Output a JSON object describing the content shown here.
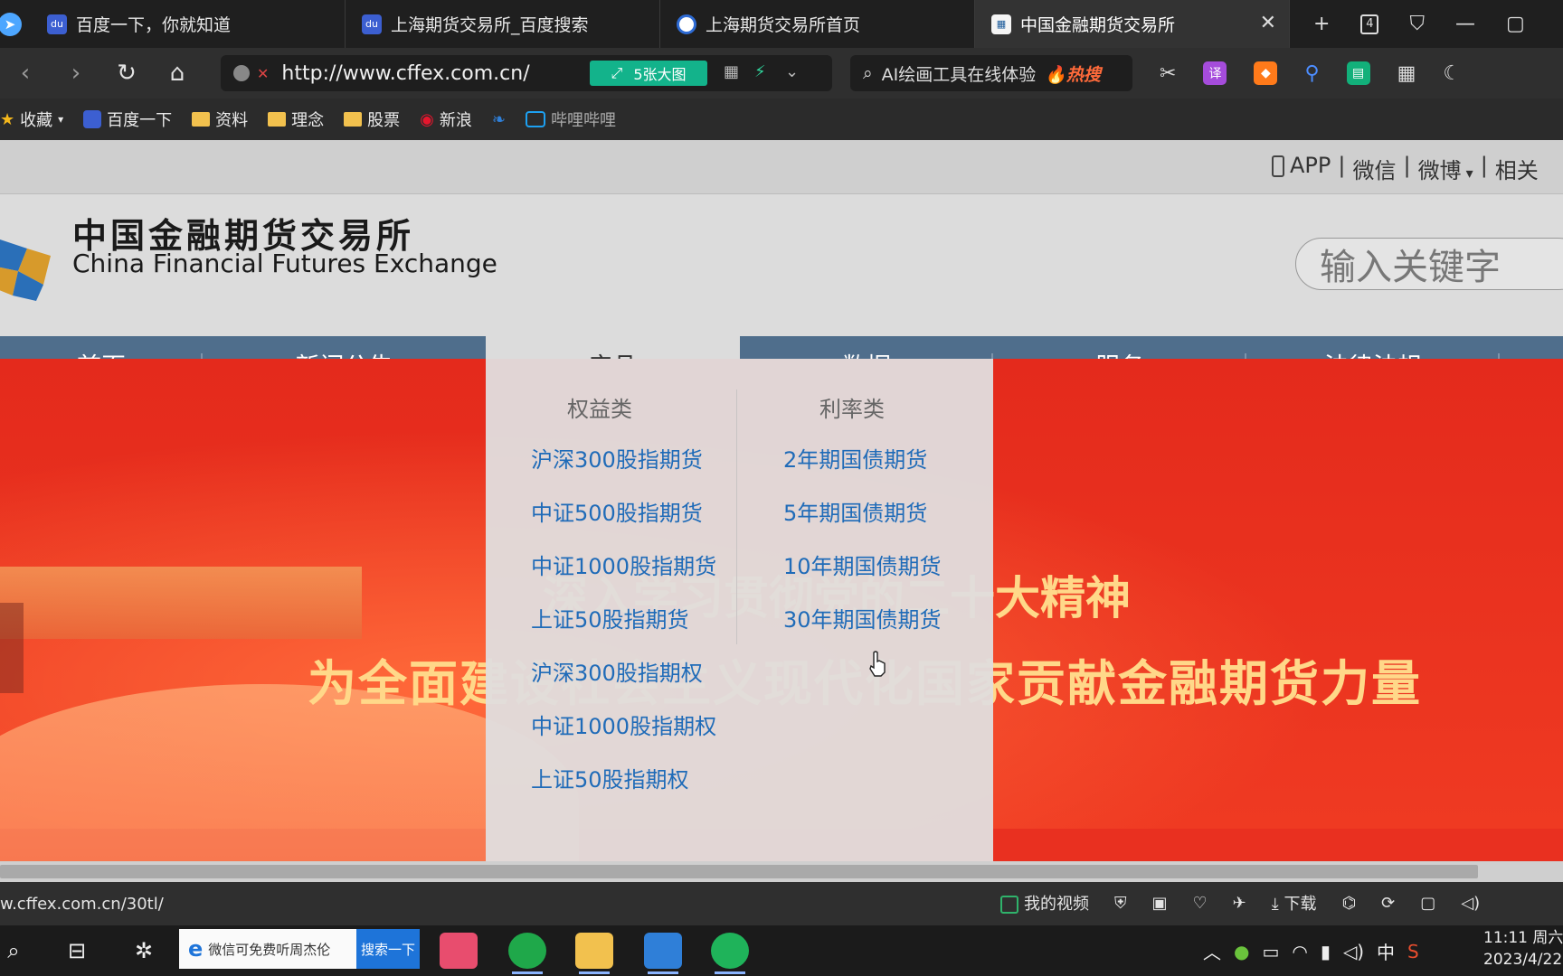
{
  "tabs": [
    {
      "label": "百度一下，你就知道",
      "favicon": "baidu-icon"
    },
    {
      "label": "上海期货交易所_百度搜索",
      "favicon": "baidu-icon"
    },
    {
      "label": "上海期货交易所首页",
      "favicon": "shfe-icon"
    },
    {
      "label": "中国金融期货交易所",
      "favicon": "cffex-icon",
      "active": true
    }
  ],
  "tab_actions": {
    "new_tab": "+",
    "tab_count": "4"
  },
  "address": {
    "url": "http://www.cffex.com.cn/",
    "image_button": "5张大图"
  },
  "search": {
    "query": "AI绘画工具在线体验",
    "hot_label": "热搜"
  },
  "toolbar_icons": {
    "translate": "译"
  },
  "bookmarks": [
    {
      "label": "收藏",
      "icon": "star-icon"
    },
    {
      "label": "百度一下",
      "icon": "baidu-icon"
    },
    {
      "label": "资料",
      "icon": "folder-icon"
    },
    {
      "label": "理念",
      "icon": "folder-icon"
    },
    {
      "label": "股票",
      "icon": "folder-icon"
    },
    {
      "label": "新浪",
      "icon": "weibo-icon"
    },
    {
      "label": "哔哩哔哩",
      "icon": "bilibili-icon"
    }
  ],
  "site": {
    "top_links": [
      "APP",
      "微信",
      "微博",
      "相关"
    ],
    "logo": {
      "cn": "中国金融期货交易所",
      "en": "China Financial Futures Exchange"
    },
    "search_placeholder": "输入关键字",
    "nav": [
      "首页",
      "新闻公告",
      "产品",
      "数据",
      "服务",
      "法律法规"
    ],
    "active_nav": "产品",
    "banner": {
      "line1": "深入学习贯彻党的二十大精神",
      "line2": "为全面建设社会主义现代化国家贡献金融期货力量"
    },
    "dropdown": {
      "col1": {
        "head": "权益类",
        "links": [
          "沪深300股指期货",
          "中证500股指期货",
          "中证1000股指期货",
          "上证50股指期货",
          "沪深300股指期权",
          "中证1000股指期权",
          "上证50股指期权"
        ]
      },
      "col2": {
        "head": "利率类",
        "links": [
          "2年期国债期货",
          "5年期国债期货",
          "10年期国债期货",
          "30年期国债期货"
        ]
      }
    }
  },
  "status": {
    "url": "w.cffex.com.cn/30tl/",
    "my_video": "我的视频",
    "download": "下载"
  },
  "taskbar": {
    "search_text": "微信可免费听周杰伦",
    "search_button": "搜索一下",
    "ime": "中",
    "time": "11:11 周六",
    "date": "2023/4/22"
  }
}
